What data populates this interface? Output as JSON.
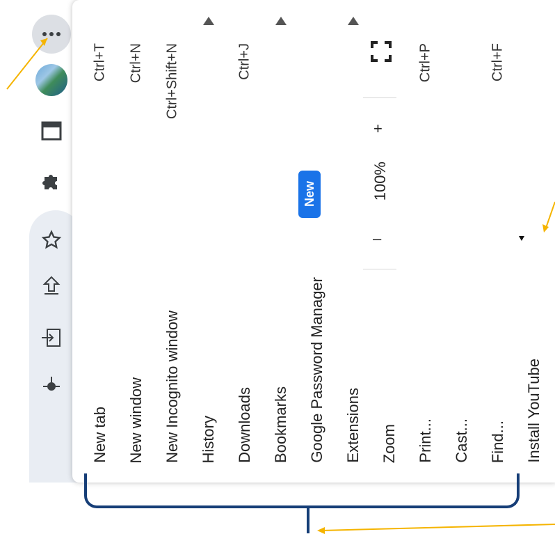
{
  "toolbar": {
    "caption": "",
    "icons": [
      "more-icon",
      "avatar",
      "window-icon",
      "extensions-icon",
      "star-icon",
      "share-icon",
      "install-icon",
      "mic-icon"
    ]
  },
  "menu": {
    "items": [
      {
        "label": "New tab",
        "shortcut": "Ctrl+T"
      },
      {
        "label": "New window",
        "shortcut": "Ctrl+N"
      },
      {
        "label": "New Incognito window",
        "shortcut": "Ctrl+Shift+N"
      },
      {
        "label": "History",
        "shortcut": ""
      },
      {
        "label": "Downloads",
        "shortcut": "Ctrl+J"
      },
      {
        "label": "Bookmarks",
        "shortcut": ""
      },
      {
        "label": "Google Password Manager",
        "badge": "New"
      },
      {
        "label": "Extensions",
        "shortcut": ""
      },
      {
        "label": "Zoom",
        "zoom_value": "100%",
        "minus": "–",
        "plus": "+"
      },
      {
        "label": "Print...",
        "shortcut": "Ctrl+P"
      },
      {
        "label": "Cast...",
        "shortcut": ""
      },
      {
        "label": "Find...",
        "shortcut": "Ctrl+F"
      },
      {
        "label": "Install YouTube",
        "shortcut": ""
      }
    ]
  },
  "colors": {
    "badge": "#1a73e8",
    "annotation_arrow": "#f5b400",
    "bracket": "#163e77"
  }
}
